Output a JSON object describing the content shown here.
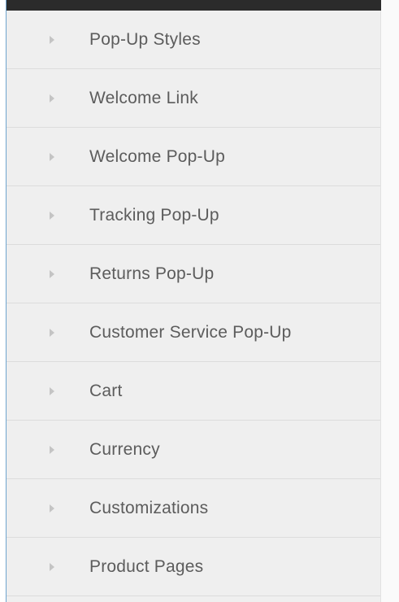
{
  "menu": {
    "items": [
      {
        "label": "Pop-Up Styles",
        "icon": "caret-right-icon"
      },
      {
        "label": "Welcome Link",
        "icon": "caret-right-icon"
      },
      {
        "label": "Welcome Pop-Up",
        "icon": "caret-right-icon"
      },
      {
        "label": "Tracking Pop-Up",
        "icon": "caret-right-icon"
      },
      {
        "label": "Returns Pop-Up",
        "icon": "caret-right-icon"
      },
      {
        "label": "Customer Service Pop-Up",
        "icon": "caret-right-icon"
      },
      {
        "label": "Cart",
        "icon": "caret-right-icon"
      },
      {
        "label": "Currency",
        "icon": "caret-right-icon"
      },
      {
        "label": "Customizations",
        "icon": "caret-right-icon"
      },
      {
        "label": "Product Pages",
        "icon": "caret-right-icon"
      }
    ]
  },
  "colors": {
    "panel_background": "#efefef",
    "header_bar": "#2b2b2b",
    "label_text": "#5c5c5c",
    "caret": "#c4c4c4",
    "left_accent": "#6ea4cf"
  }
}
